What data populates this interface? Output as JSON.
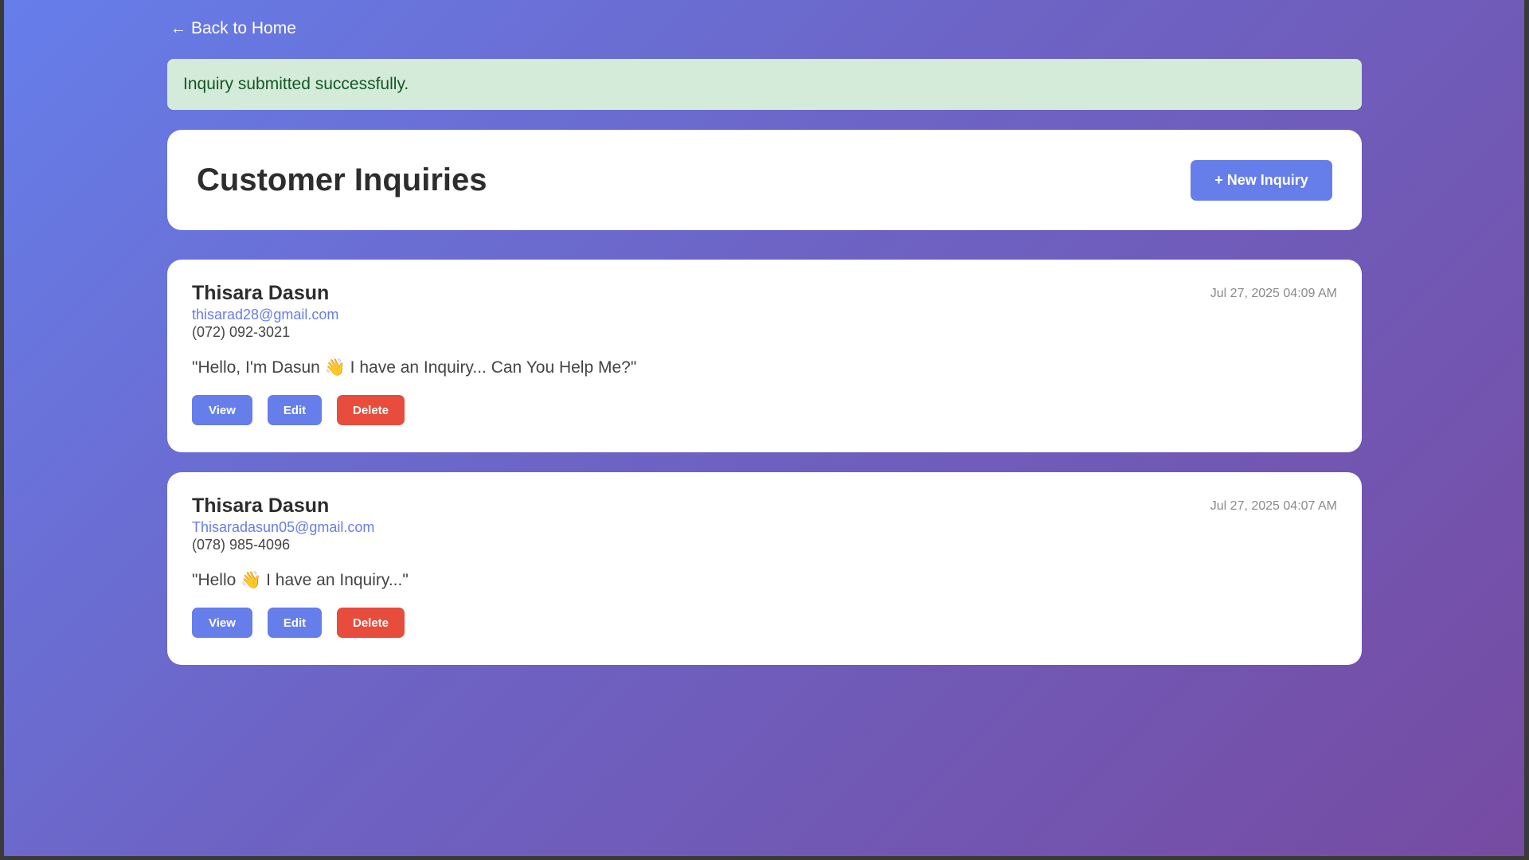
{
  "nav": {
    "back_icon": "arrow-left-icon",
    "back_glyph": "←",
    "back_label": "Back to Home"
  },
  "alert": {
    "message": "Inquiry submitted successfully."
  },
  "header": {
    "title": "Customer Inquiries",
    "new_button_label": "+ New Inquiry"
  },
  "inquiries": [
    {
      "name": "Thisara Dasun",
      "email": "thisarad28@gmail.com",
      "phone": "(072) 092-3021",
      "date": "Jul 27, 2025 04:09 AM",
      "message": "\"Hello, I'm Dasun 👋 I have an Inquiry... Can You Help Me?\"",
      "actions": {
        "view": "View",
        "edit": "Edit",
        "delete": "Delete"
      }
    },
    {
      "name": "Thisara Dasun",
      "email": "Thisaradasun05@gmail.com",
      "phone": "(078) 985-4096",
      "date": "Jul 27, 2025 04:07 AM",
      "message": "\"Hello 👋 I have an Inquiry...\"",
      "actions": {
        "view": "View",
        "edit": "Edit",
        "delete": "Delete"
      }
    }
  ],
  "colors": {
    "gradient_start": "#667eea",
    "gradient_end": "#764ba2",
    "accent": "#667eea",
    "danger": "#e74c3c",
    "success_bg": "#d4ebda",
    "success_text": "#155724"
  }
}
